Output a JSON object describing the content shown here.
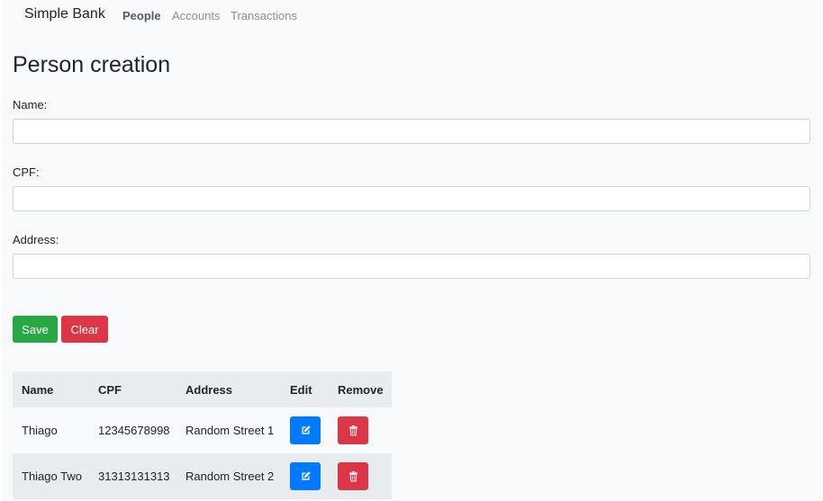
{
  "navbar": {
    "brand": "Simple Bank",
    "links": [
      {
        "label": "People",
        "active": true
      },
      {
        "label": "Accounts",
        "active": false
      },
      {
        "label": "Transactions",
        "active": false
      }
    ]
  },
  "form": {
    "title": "Person creation",
    "fields": [
      {
        "label": "Name:",
        "value": "",
        "placeholder": ""
      },
      {
        "label": "CPF:",
        "value": "",
        "placeholder": ""
      },
      {
        "label": "Address:",
        "value": "",
        "placeholder": ""
      }
    ],
    "save_label": "Save",
    "clear_label": "Clear"
  },
  "table": {
    "headers": [
      "Name",
      "CPF",
      "Address",
      "Edit",
      "Remove"
    ],
    "rows": [
      {
        "name": "Thiago",
        "cpf": "12345678998",
        "address": "Random Street 1"
      },
      {
        "name": "Thiago Two",
        "cpf": "31313131313",
        "address": "Random Street 2"
      }
    ]
  },
  "icons": {
    "edit": "edit-icon",
    "remove": "trash-icon"
  },
  "colors": {
    "save": "#28a745",
    "clear": "#dc3545",
    "edit": "#007bff",
    "remove": "#dc3545"
  }
}
